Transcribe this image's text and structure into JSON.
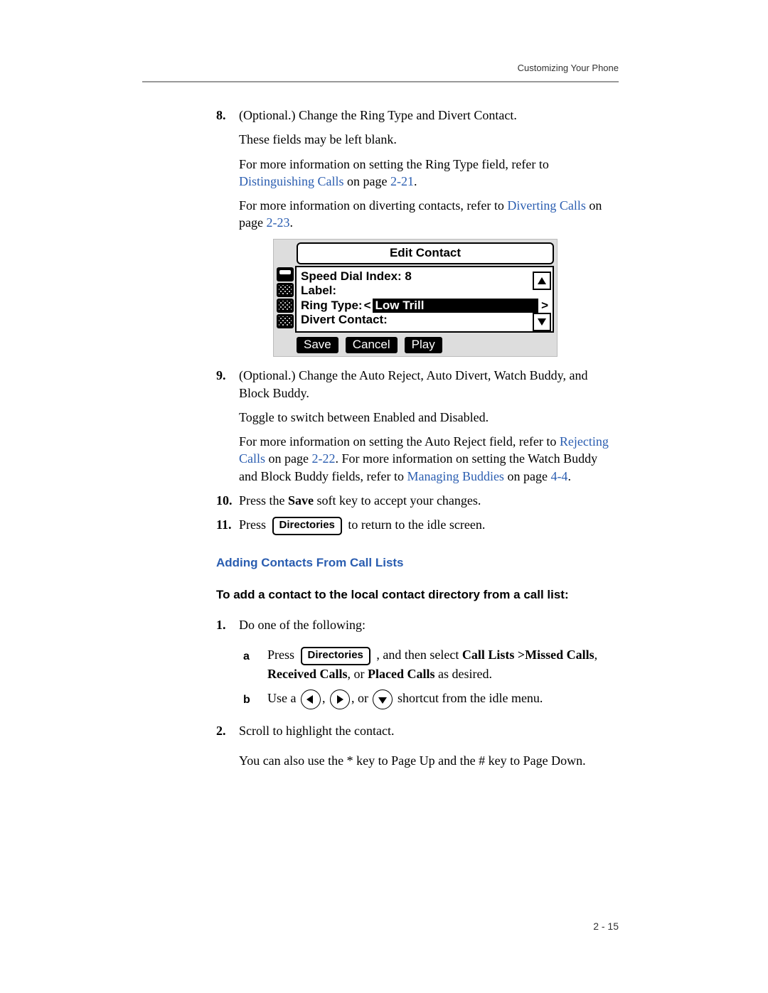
{
  "header": {
    "running_head": "Customizing Your Phone"
  },
  "steps": {
    "s8": {
      "num": "8.",
      "l1": "(Optional.) Change the Ring Type and Divert Contact.",
      "l2": "These fields may be left blank.",
      "l3a": "For more information on setting the Ring Type field, refer to ",
      "l3link": "Distinguishing Calls",
      "l3b": " on page ",
      "l3pg": "2-21",
      "l3c": ".",
      "l4a": "For more information on diverting contacts, refer to ",
      "l4link": "Diverting Calls",
      "l4b": " on page ",
      "l4pg": "2-23",
      "l4c": "."
    },
    "s9": {
      "num": "9.",
      "l1": "(Optional.) Change the Auto Reject, Auto Divert, Watch Buddy, and Block Buddy.",
      "l2": "Toggle to switch between Enabled and Disabled.",
      "l3a": "For more information on setting the Auto Reject field, refer to ",
      "l3link": "Rejecting Calls",
      "l3b": " on page ",
      "l3pg": "2-22",
      "l3c": ". For more information on setting the Watch Buddy and Block Buddy fields, refer to ",
      "l3link2": "Managing Buddies",
      "l3d": " on page ",
      "l3pg2": "4-4",
      "l3e": "."
    },
    "s10": {
      "num": "10.",
      "a": "Press the ",
      "b": "Save",
      "c": " soft key to accept your changes."
    },
    "s11": {
      "num": "11.",
      "a": "Press ",
      "key": "Directories",
      "b": " to return to the idle screen."
    }
  },
  "screenshot": {
    "title": "Edit Contact",
    "row1": "Speed Dial Index: 8",
    "row2": "Label:",
    "row3_label": "Ring Type: ",
    "row3_lt": "<",
    "row3_val": "Low Trill",
    "row3_gt": ">",
    "row4": "Divert Contact:",
    "softkeys": [
      "Save",
      "Cancel",
      "Play"
    ]
  },
  "section": {
    "heading": "Adding Contacts From Call Lists"
  },
  "proc": {
    "title": "To add a contact to the local contact directory from a call list:",
    "s1": {
      "num": "1.",
      "text": "Do one of the following:",
      "a": {
        "let": "a",
        "t1": "Press ",
        "key": "Directories",
        "t2": " , and then select ",
        "b1": "Call Lists >",
        "b2": "Missed Calls",
        "t3": ", ",
        "b3": "Received Calls",
        "t4": ", or ",
        "b4": "Placed Calls",
        "t5": " as desired."
      },
      "b": {
        "let": "b",
        "t1": "Use a ",
        "t2": ", ",
        "t3": ", or ",
        "t4": " shortcut from the idle menu."
      }
    },
    "s2": {
      "num": "2.",
      "l1": "Scroll to highlight the contact.",
      "l2": "You can also use the * key to Page Up and the # key to Page Down."
    }
  },
  "footer": {
    "pagenum": "2 - 15"
  }
}
